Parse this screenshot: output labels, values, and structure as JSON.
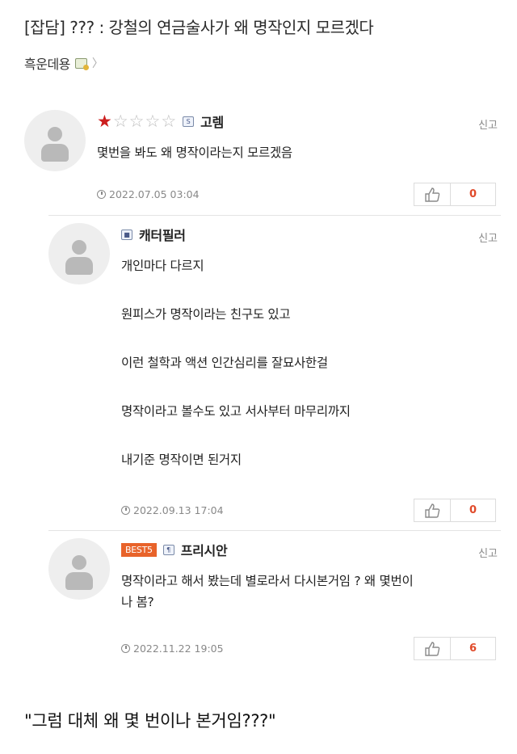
{
  "post": {
    "title": "[잡담] ??? : 강철의 연금술사가 왜 명작인지 모르겠다",
    "author": "흑운데용",
    "chevron": "〉"
  },
  "comments": [
    {
      "nickname": "고렘",
      "rating": 1,
      "rating_max": 5,
      "star_on": "★",
      "star_off": "☆",
      "grade_icon": "S",
      "report": "신고",
      "lines": [
        "몇번을 봐도 왜 명작이라는지 모르겠음"
      ],
      "date": "2022.07.05 03:04",
      "likes": "0"
    },
    {
      "nickname": "캐터필러",
      "grade_icon": "■",
      "report": "신고",
      "lines": [
        "개인마다 다르지",
        "원피스가 명작이라는 친구도 있고",
        "이런 철학과 액션 인간심리를 잘묘사한걸",
        "명작이라고 볼수도 있고 서사부터 마무리까지",
        "내기준 명작이면 된거지"
      ],
      "date": "2022.09.13 17:04",
      "likes": "0"
    },
    {
      "nickname": "프리시안",
      "badge": "BEST5",
      "grade_icon": "¶",
      "report": "신고",
      "lines": [
        "명작이라고 해서 봤는데 별로라서 다시본거임 ? 왜 몇번이",
        "나 봄?"
      ],
      "date": "2022.11.22 19:05",
      "likes": "6"
    }
  ],
  "caption": "\"그럼 대체 왜 몇 번이나 본거임???\"",
  "colors": {
    "star_on": "#cc1e1e",
    "star_off": "#bdbdbd",
    "like_count": "#e04a2a",
    "best_badge": "#e8632a"
  }
}
